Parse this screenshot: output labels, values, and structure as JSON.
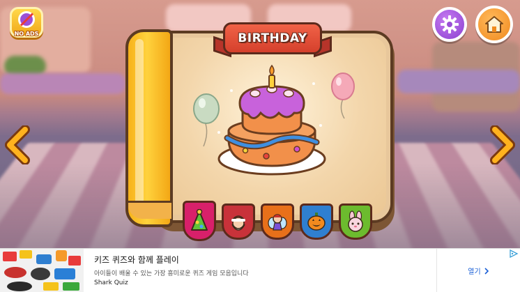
{
  "screen": {
    "banner_title": "BIRTHDAY",
    "no_ads_label": "NO ADS",
    "colors": {
      "book_spine": "#ffd23d",
      "book_page": "#e8c79b",
      "banner": "#e04a33",
      "settings_button": "#9b4fd6",
      "home_button": "#f59a2a",
      "arrow": "#f7a81c"
    },
    "icons": {
      "no_ads": "no-ads-icon",
      "settings": "gear-icon",
      "home": "house-icon",
      "prev": "chevron-left-icon",
      "next": "chevron-right-icon"
    },
    "categories": [
      {
        "name": "party-hat",
        "color": "#d8206a",
        "active": true
      },
      {
        "name": "santa",
        "color": "#c8323a",
        "active": false
      },
      {
        "name": "fairy",
        "color": "#e8701a",
        "active": false
      },
      {
        "name": "pumpkin",
        "color": "#2f7fd0",
        "active": false
      },
      {
        "name": "bunny",
        "color": "#6cbb2e",
        "active": false
      }
    ]
  },
  "ad": {
    "title": "키즈 퀴즈와 함께 플레이",
    "description": "아이들이 배울 수 있는 가장 흥미로운 퀴즈 게임 모음입니다",
    "brand": "Shark Quiz",
    "cta": "열기"
  }
}
